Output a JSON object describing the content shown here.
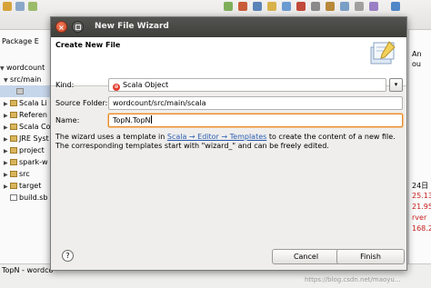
{
  "ide": {
    "package_explorer_tab": "Package E",
    "tree": [
      {
        "label": "wordcount",
        "expanded": true
      },
      {
        "label": "src/main",
        "expanded": true
      },
      {
        "label": "",
        "selected": true
      },
      {
        "label": "Scala Li"
      },
      {
        "label": "Referen"
      },
      {
        "label": "Scala Co"
      },
      {
        "label": "JRE Syst"
      },
      {
        "label": "project"
      },
      {
        "label": "spark-w"
      },
      {
        "label": "src"
      },
      {
        "label": "target"
      },
      {
        "label": "build.sb"
      }
    ],
    "bottom_tab": "TopN - wordco",
    "right_panel": {
      "line1": "An",
      "line2": "ou",
      "line3": "24日",
      "line4": "25.13",
      "line5": "21.95",
      "line6": "rver",
      "line7": "168.2"
    },
    "watermark": "https://blog.csdn.net/maoyu..."
  },
  "dialog": {
    "title": "New File Wizard",
    "header_title": "Create New File",
    "kind_label": "Kind:",
    "kind_value": "Scala Object",
    "source_folder_label": "Source Folder:",
    "source_folder_value": "wordcount/src/main/scala",
    "name_label": "Name:",
    "name_value": "TopN.TopN",
    "description": {
      "part1": "The wizard uses a template in ",
      "link": "Scala → Editor → Templates",
      "part2": " to create the content of a new file.",
      "line2": "The corresponding templates start with \"wizard_\" and can be freely edited."
    },
    "help_label": "?",
    "cancel_label": "Cancel",
    "finish_label": "Finish"
  }
}
